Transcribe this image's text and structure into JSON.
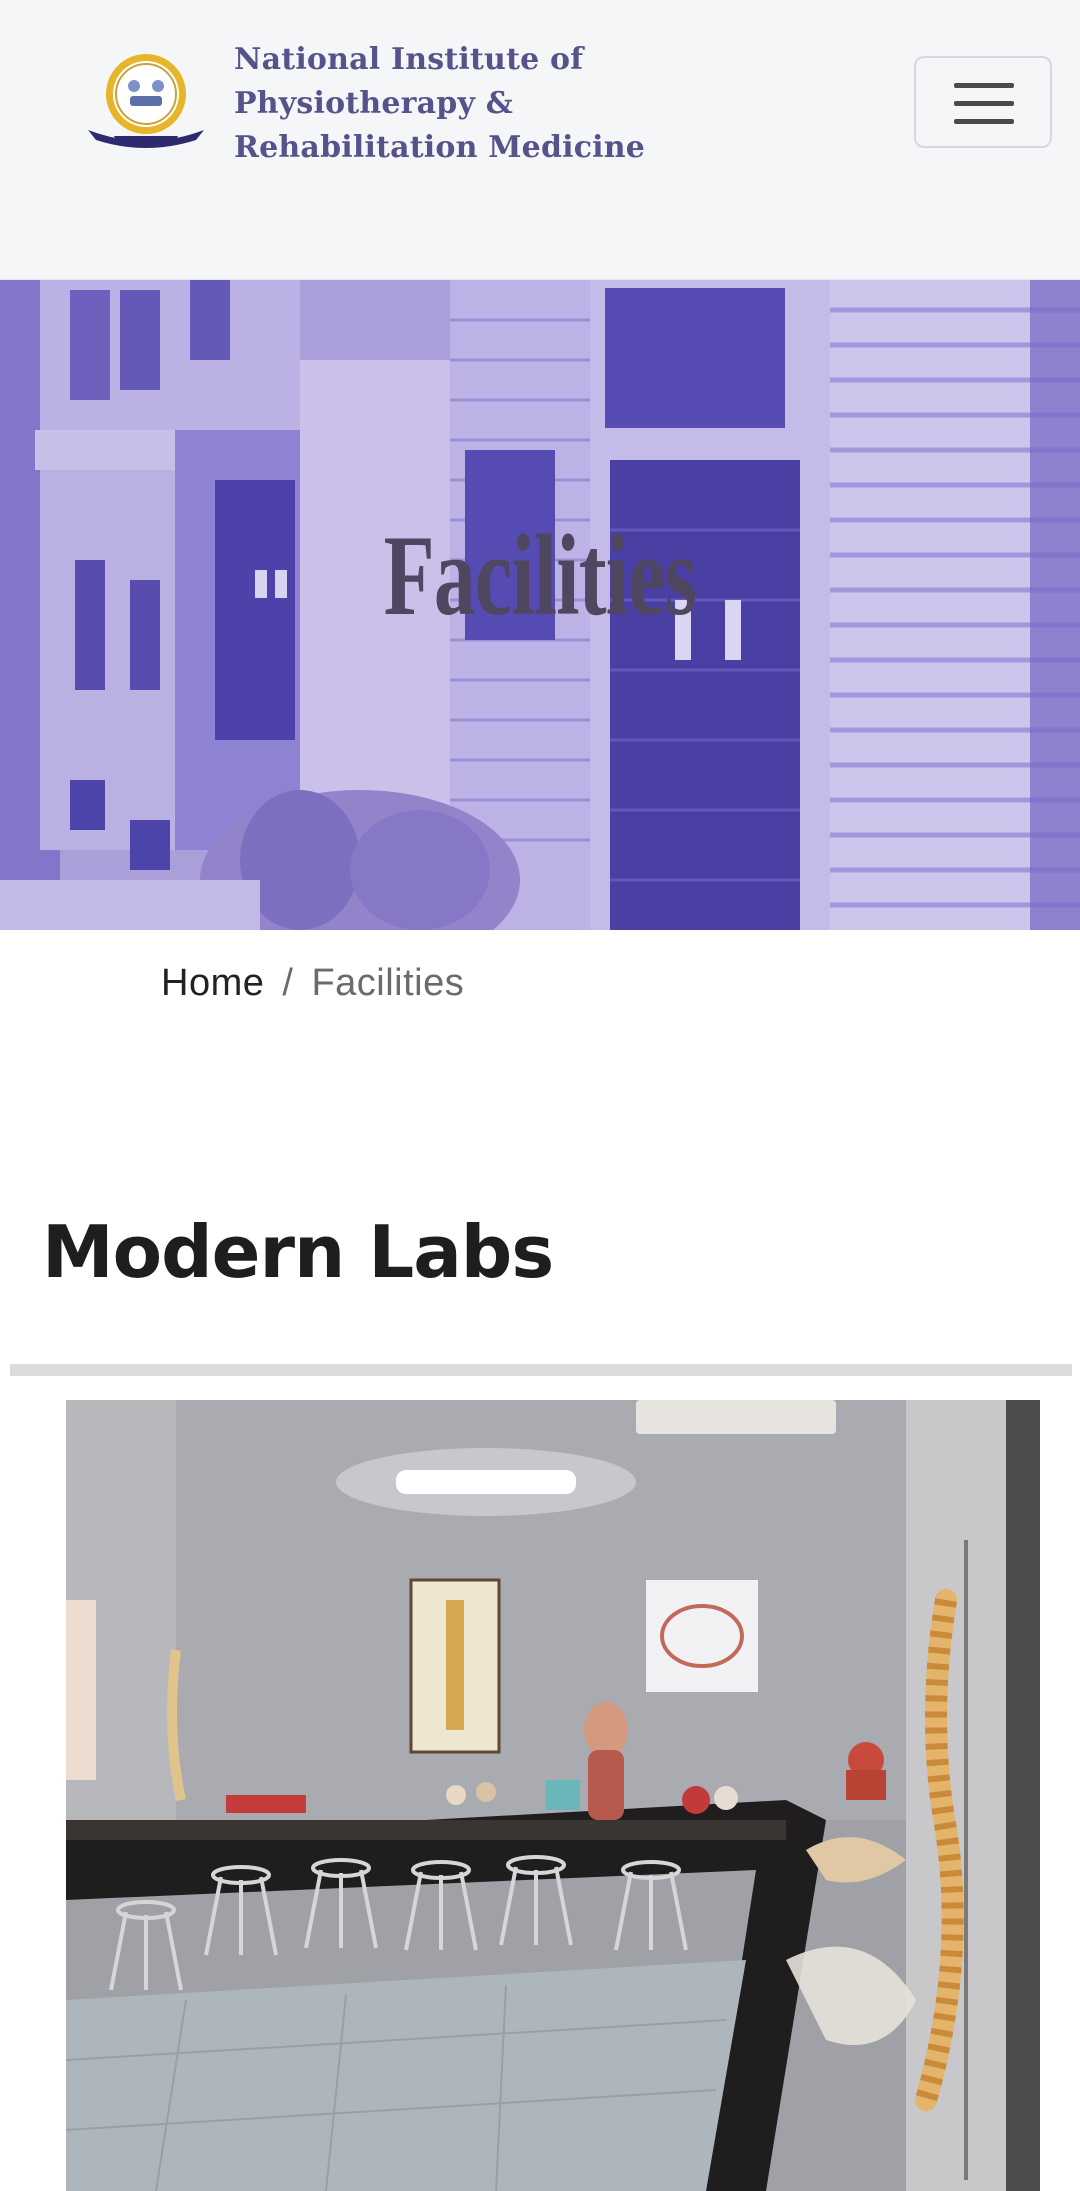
{
  "header": {
    "brand_line_1": "National Institute of",
    "brand_line_2": "Physiotherapy &",
    "brand_line_3": "Rehabilitation Medicine",
    "logo_icon": "institute-crest-icon",
    "menu_icon": "hamburger-menu-icon"
  },
  "banner": {
    "title": "Facilities"
  },
  "breadcrumb": {
    "home": "Home",
    "separator": "/",
    "current": "Facilities"
  },
  "section": {
    "title": "Modern Labs"
  },
  "colors": {
    "brand_text": "#58528a",
    "banner_tint": "#8a7fd0",
    "divider": "#dcdcdf"
  }
}
